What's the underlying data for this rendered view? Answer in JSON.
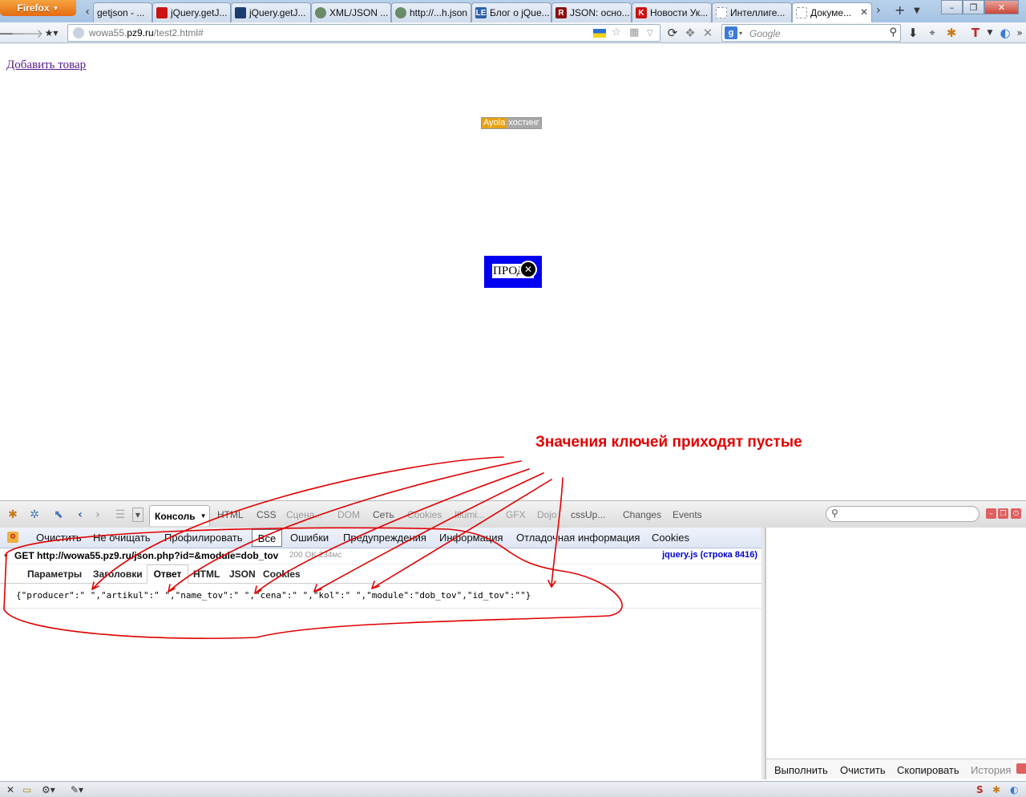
{
  "browser": {
    "menu_label": "Firefox",
    "tabs": [
      {
        "label": "getjson - ...",
        "fav_color": "#d0d0d0",
        "fav_char": ""
      },
      {
        "label": "jQuery.getJ...",
        "fav_color": "#cc1111",
        "fav_char": ""
      },
      {
        "label": "jQuery.getJ...",
        "fav_color": "#1a3d6e",
        "fav_char": ""
      },
      {
        "label": "XML/JSON ...",
        "fav_color": "#6a8a6a",
        "fav_char": ""
      },
      {
        "label": "http://...h.json",
        "fav_color": "#6a8a6a",
        "fav_char": ""
      },
      {
        "label": "Блог о jQue...",
        "fav_color": "#2b5fa8",
        "fav_char": "LE"
      },
      {
        "label": "JSON: осно...",
        "fav_color": "#8a1010",
        "fav_char": "R"
      },
      {
        "label": "Новости Ук...",
        "fav_color": "#cc1111",
        "fav_char": "K"
      },
      {
        "label": "Интеллиге...",
        "fav_color": "#ffffff",
        "fav_char": ""
      },
      {
        "label": "Докуме...",
        "fav_color": "#ffffff",
        "fav_char": ""
      }
    ],
    "url_host": "wowa55.",
    "url_domain": "pz9.ru",
    "url_path": "/test2.html#",
    "search_placeholder": "Google",
    "search_engine_letter": "g"
  },
  "page": {
    "add_product_link": "Добавить товар",
    "host_brand": "Ayola",
    "host_word": "хостинг",
    "popup_text": "ПРОД",
    "annotation": "Значения ключей приходят пустые"
  },
  "firebug": {
    "console_tab": "Консоль",
    "panel_tabs": [
      {
        "label": "HTML",
        "dim": false
      },
      {
        "label": "CSS",
        "dim": false
      },
      {
        "label": "Сцена...",
        "dim": true
      },
      {
        "label": "DOM",
        "dim": true
      },
      {
        "label": "Сеть",
        "dim": false
      },
      {
        "label": "Cookies",
        "dim": true
      },
      {
        "label": "Illumi...",
        "dim": true
      },
      {
        "label": "GFX",
        "dim": true
      },
      {
        "label": "Dojo",
        "dim": true
      },
      {
        "label": "cssUp...",
        "dim": false
      },
      {
        "label": "Changes",
        "dim": false
      },
      {
        "label": "Events",
        "dim": false
      }
    ],
    "console_toolbar": {
      "clear": "Очистить",
      "persist": "Не очищать",
      "profile": "Профилировать",
      "all": "Все",
      "errors": "Ошибки",
      "warnings": "Предупреждения",
      "info": "Информация",
      "debug": "Отладочная информация",
      "cookies": "Cookies"
    },
    "request": {
      "line": "GET http://wowa55.pz9.ru/json.php?id=&module=dob_tov",
      "status": "200 OK 234мс",
      "source": "jquery.js (строка 8416)"
    },
    "request_tabs": {
      "params": "Параметры",
      "headers": "Заголовки",
      "response": "Ответ",
      "html": "HTML",
      "json": "JSON",
      "cookies": "Cookies"
    },
    "response_body": "{\"producer\":\" \",\"artikul\":\" \",\"name_tov\":\" \",\"cena\":\" \",\"kol\":\" \",\"module\":\"dob_tov\",\"id_tov\":\"\"}",
    "side": {
      "run": "Выполнить",
      "clear": "Очистить",
      "copy": "Скопировать",
      "history": "История"
    }
  },
  "colors": {
    "annotation": "#e00000",
    "link": "#551a8b",
    "popup_bg": "#0000f0",
    "source_link": "#0000cc"
  }
}
